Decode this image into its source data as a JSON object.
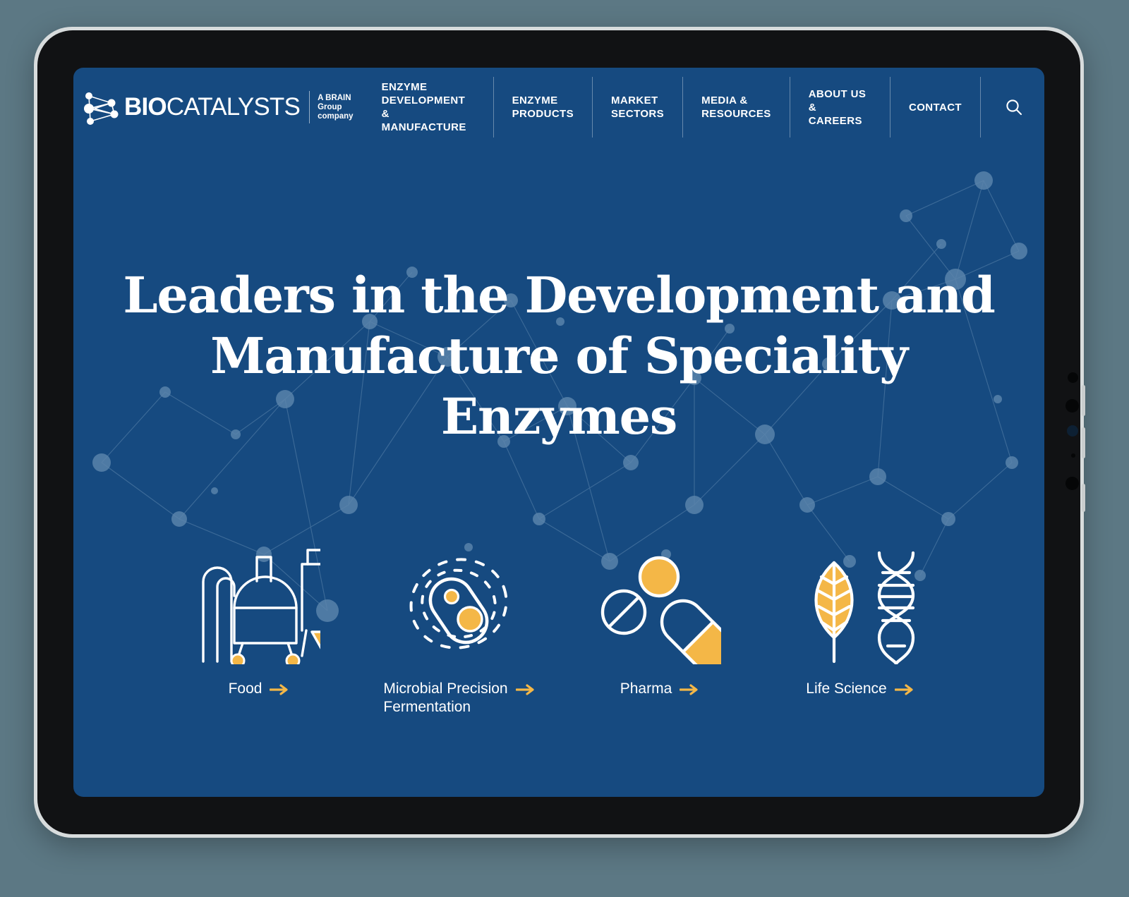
{
  "device": {
    "type": "tablet-mockup",
    "frame_color": "#d8dcdd",
    "bezel_color": "#111214"
  },
  "theme": {
    "page_background": "#5c7884",
    "brand_blue": "#164a80",
    "accent_amber": "#f4b747",
    "text_white": "#ffffff",
    "network_node": "#4f78a4"
  },
  "header": {
    "logo": {
      "mark_name": "biocatalysts-network-mark",
      "word_bold": "BIO",
      "word_light": "CATALYSTS",
      "tagline_line1": "A BRAIN",
      "tagline_line2": "Group",
      "tagline_line3": "company"
    },
    "nav_items": [
      {
        "id": "enzyme-development-manufacture",
        "label": "ENZYME\nDEVELOPMENT\n& MANUFACTURE"
      },
      {
        "id": "enzyme-products",
        "label": "ENZYME\nPRODUCTS"
      },
      {
        "id": "market-sectors",
        "label": "MARKET\nSECTORS"
      },
      {
        "id": "media-resources",
        "label": "MEDIA &\nRESOURCES"
      },
      {
        "id": "about-us-careers",
        "label": "ABOUT US\n& CAREERS"
      },
      {
        "id": "contact",
        "label": "CONTACT"
      }
    ],
    "search_icon": "search-icon"
  },
  "hero": {
    "heading_line1": "Leaders in the Development and",
    "heading_line2": "Manufacture of Speciality Enzymes"
  },
  "categories": [
    {
      "id": "food",
      "label": "Food",
      "icon": "fermentation-tank-icon",
      "arrow": "arrow-right-icon"
    },
    {
      "id": "microbial-precision-fermentation",
      "label": "Microbial Precision\nFermentation",
      "icon": "microbe-cell-icon",
      "arrow": "arrow-right-icon"
    },
    {
      "id": "pharma",
      "label": "Pharma",
      "icon": "pills-capsule-icon",
      "arrow": "arrow-right-icon"
    },
    {
      "id": "life-science",
      "label": "Life Science",
      "icon": "leaf-dna-icon",
      "arrow": "arrow-right-icon"
    }
  ]
}
